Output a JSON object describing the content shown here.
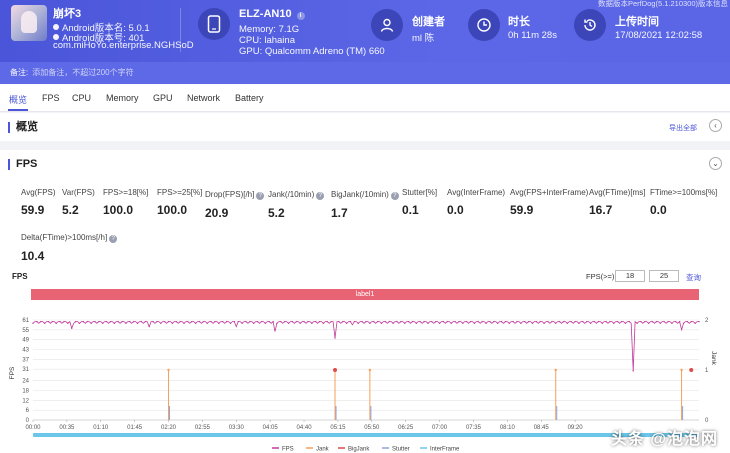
{
  "app": {
    "name": "崩坏3",
    "android_name": "Android版本名: 5.0.1",
    "android_code": "Android版本号: 401",
    "package": "com.miHoYo.enterprise.NGHSoD"
  },
  "device": {
    "model": "ELZ-AN10",
    "memory": "Memory: 7.1G",
    "cpu": "CPU: lahaina",
    "gpu": "GPU: Qualcomm Adreno (TM) 660"
  },
  "creator": {
    "label": "创建者",
    "value": "ml 陈"
  },
  "duration": {
    "label": "时长",
    "value": "0h 11m 28s"
  },
  "upload": {
    "label": "上传时间",
    "value": "17/08/2021 12:02:58",
    "version": "数据版本PerfDog(5.1.210300)版本信息"
  },
  "notes": {
    "label": "备注:",
    "placeholder": "添加备注，不超过200个字符"
  },
  "tabs": [
    "概览",
    "FPS",
    "CPU",
    "Memory",
    "GPU",
    "Network",
    "Battery"
  ],
  "overview": {
    "title": "概览",
    "export_label": "导出全部",
    "collapse_icon": "chevron-left-icon"
  },
  "fps_section": {
    "title": "FPS",
    "stats": [
      {
        "label": "Avg(FPS)",
        "value": "59.9",
        "help": false
      },
      {
        "label": "Var(FPS)",
        "value": "5.2",
        "help": false
      },
      {
        "label": "FPS>=18[%]",
        "value": "100.0",
        "help": false
      },
      {
        "label": "FPS>=25[%]",
        "value": "100.0",
        "help": false
      },
      {
        "label": "Drop(FPS)[/h]",
        "value": "20.9",
        "help": true
      },
      {
        "label": "Jank(/10min)",
        "value": "5.2",
        "help": true
      },
      {
        "label": "BigJank(/10min)",
        "value": "1.7",
        "help": true
      },
      {
        "label": "Stutter[%]",
        "value": "0.1",
        "help": false
      },
      {
        "label": "Avg(InterFrame)",
        "value": "0.0",
        "help": false
      },
      {
        "label": "Avg(FPS+InterFrame)",
        "value": "59.9",
        "help": false
      },
      {
        "label": "Avg(FTime)[ms]",
        "value": "16.7",
        "help": false
      },
      {
        "label": "FTime>=100ms[%]",
        "value": "0.0",
        "help": false
      },
      {
        "label": "Delta(FTime)>100ms[/h]",
        "value": "10.4",
        "help": true
      }
    ]
  },
  "chart_header": {
    "title": "FPS",
    "filter_label": "FPS(>=)",
    "filter_1": "18",
    "filter_2": "25",
    "query_label": "查询",
    "band_label": "label1"
  },
  "chart_data": {
    "type": "line",
    "x_ticks": [
      "00:00",
      "00:35",
      "01:10",
      "01:45",
      "02:20",
      "02:55",
      "03:30",
      "04:05",
      "04:40",
      "05:15",
      "05:50",
      "06:25",
      "07:00",
      "07:35",
      "08:10",
      "08:45",
      "09:20"
    ],
    "y_ticks": [
      "0",
      "6",
      "12",
      "18",
      "24",
      "31",
      "37",
      "43",
      "49",
      "55",
      "61"
    ],
    "y2_ticks": [
      "0",
      "1",
      "2"
    ],
    "ylabel": "FPS",
    "y2label": "Jank",
    "ylim": [
      0,
      61
    ],
    "y2lim": [
      0,
      2
    ],
    "x_duration_s": 688,
    "series": [
      {
        "name": "FPS",
        "color": "#c0399a",
        "baseline": 60,
        "dips": [
          [
            40,
            56
          ],
          [
            120,
            57
          ],
          [
            210,
            57
          ],
          [
            250,
            54
          ],
          [
            312,
            50
          ],
          [
            330,
            58
          ],
          [
            445,
            56
          ],
          [
            585,
            57
          ],
          [
            603,
            40
          ],
          [
            607,
            52
          ],
          [
            620,
            30
          ],
          [
            655,
            30
          ],
          [
            670,
            55
          ]
        ]
      },
      {
        "name": "Jank",
        "color": "#f5a05c",
        "events": [
          140,
          312,
          348,
          540,
          670
        ]
      },
      {
        "name": "BigJank",
        "color": "#e14a4a",
        "events": [
          312,
          680
        ]
      },
      {
        "name": "Stutter",
        "color": "#8ea3d9",
        "events": [
          140,
          312,
          348,
          540,
          670
        ]
      },
      {
        "name": "InterFrame",
        "color": "#6bc6ea"
      }
    ],
    "legend_position": "bottom"
  },
  "watermark": "头条 @泡泡网"
}
